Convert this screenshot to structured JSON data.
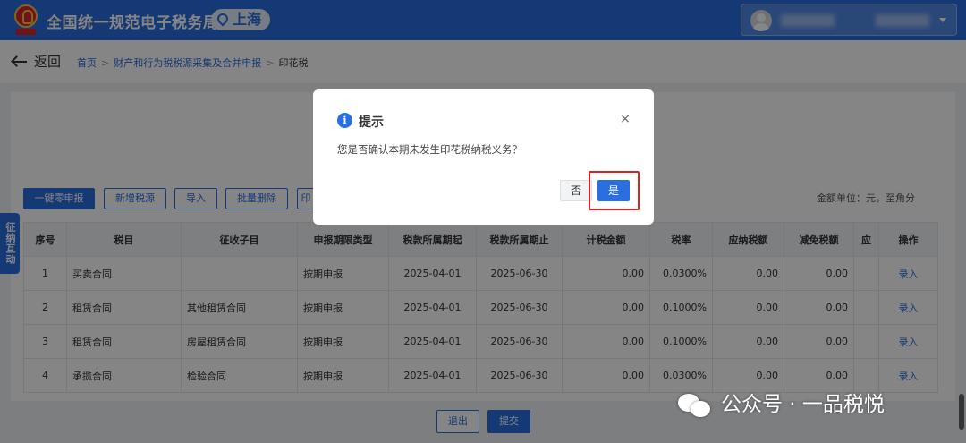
{
  "header": {
    "title": "全国统一规范电子税务局",
    "region": "上海"
  },
  "nav": {
    "back_label": "返回",
    "breadcrumb": [
      "首页",
      "财产和行为税税源采集及合并申报",
      "印花税"
    ],
    "separator": ">"
  },
  "toolbar": {
    "buttons": [
      "一键零申报",
      "新增税源",
      "导入",
      "批量删除",
      "印"
    ],
    "unit_note": "金额单位：元，至角分"
  },
  "side_tab": {
    "label": "征纳互动"
  },
  "table": {
    "columns": [
      "序号",
      "税目",
      "征收子目",
      "申报期限类型",
      "税款所属期起",
      "税款所属期止",
      "计税金额",
      "税率",
      "应纳税额",
      "减免税额",
      "应",
      "操作"
    ],
    "rows": [
      [
        "1",
        "买卖合同",
        "",
        "按期申报",
        "2025-04-01",
        "2025-06-30",
        "0.00",
        "0.0300%",
        "0.00",
        "0.00",
        "",
        "录入"
      ],
      [
        "2",
        "租赁合同",
        "其他租赁合同",
        "按期申报",
        "2025-04-01",
        "2025-06-30",
        "0.00",
        "0.1000%",
        "0.00",
        "0.00",
        "",
        "录入"
      ],
      [
        "3",
        "租赁合同",
        "房屋租赁合同",
        "按期申报",
        "2025-04-01",
        "2025-06-30",
        "0.00",
        "0.1000%",
        "0.00",
        "0.00",
        "",
        "录入"
      ],
      [
        "4",
        "承揽合同",
        "检验合同",
        "按期申报",
        "2025-04-01",
        "2025-06-30",
        "0.00",
        "0.0300%",
        "0.00",
        "0.00",
        "",
        "录入"
      ]
    ]
  },
  "footer": {
    "exit_label": "退出",
    "submit_label": "提交"
  },
  "watermark": {
    "text": "公众号 · 一品税悦"
  },
  "dialog": {
    "title": "提示",
    "info_glyph": "i",
    "close_glyph": "×",
    "message": "您是否确认本期未发生印花税纳税义务？",
    "no_label": "否",
    "yes_label": "是"
  },
  "colors": {
    "brand_blue": "#2a6ee0",
    "highlight_red": "#e0201e",
    "seal_red": "#d8262a",
    "seal_gold": "#f3c340"
  }
}
